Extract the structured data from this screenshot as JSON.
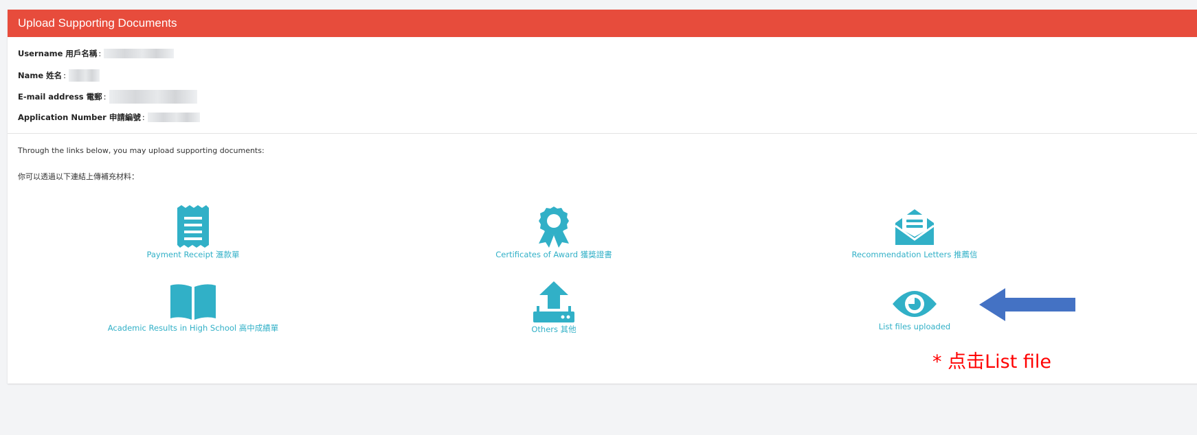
{
  "panel": {
    "title": "Upload Supporting Documents",
    "header_color": "#e74c3c"
  },
  "info": {
    "username_label": "Username 用戶名稱",
    "name_label": "Name 姓名",
    "email_label": "E-mail address 電郵",
    "application_label": "Application Number 申請編號",
    "colon": ":"
  },
  "intro": {
    "line_en": "Through the links below, you may upload supporting documents:",
    "line_zh": "你可以透過以下連結上傳補充材料："
  },
  "links": {
    "payment_receipt": {
      "label": "Payment Receipt 滙款單",
      "icon": "receipt-icon"
    },
    "certificates_of_award": {
      "label": "Certificates of Award 獲獎證書",
      "icon": "award-icon"
    },
    "recommendation_letters": {
      "label": "Recommendation Letters 推薦信",
      "icon": "envelope-letter-icon"
    },
    "academic_results": {
      "label": "Academic Results in High School 高中成績單",
      "icon": "book-icon"
    },
    "others": {
      "label": "Others 其他",
      "icon": "upload-icon"
    },
    "list_files": {
      "label": "List files uploaded",
      "icon": "eye-icon"
    }
  },
  "annotation": {
    "text": "* 点击List file",
    "arrow_color": "#4472c4",
    "text_color": "#ff0000"
  },
  "colors": {
    "accent": "#31b0c7"
  }
}
